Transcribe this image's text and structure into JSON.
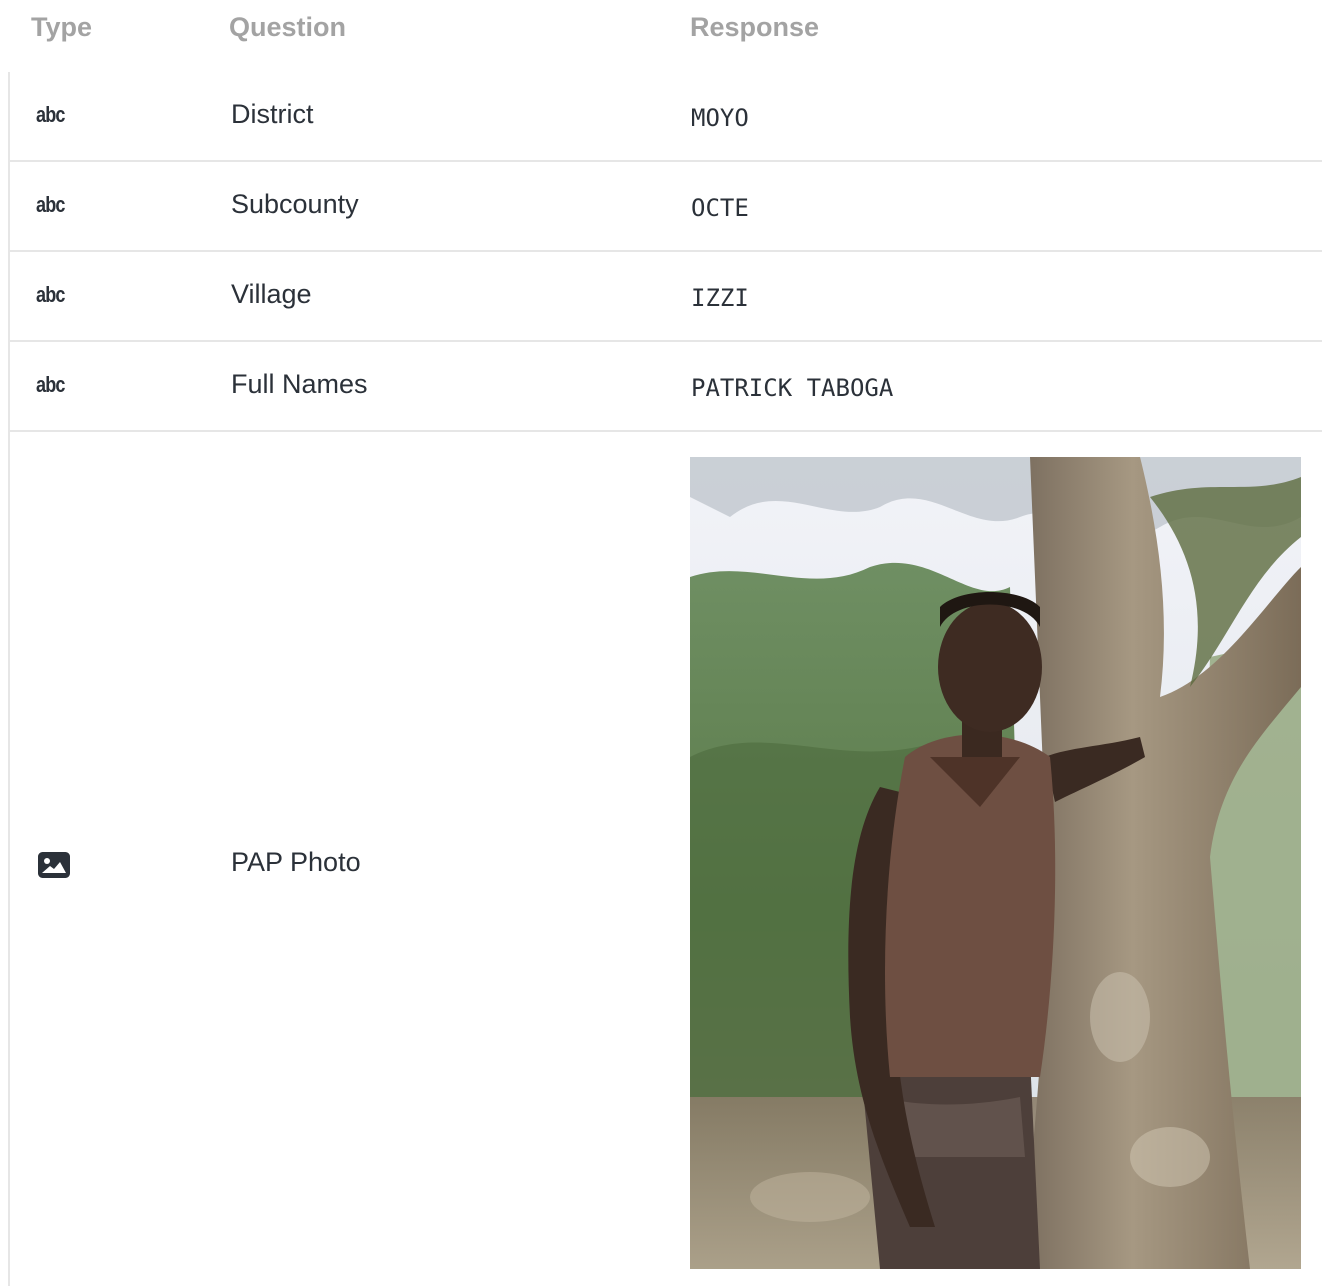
{
  "header": {
    "type_label": "Type",
    "question_label": "Question",
    "response_label": "Response"
  },
  "rows": [
    {
      "type_icon": "abc-text-icon",
      "type_text": "abc",
      "question": "District",
      "response": "MOYO"
    },
    {
      "type_icon": "abc-text-icon",
      "type_text": "abc",
      "question": "Subcounty",
      "response": "OCTE"
    },
    {
      "type_icon": "abc-text-icon",
      "type_text": "abc",
      "question": "Village",
      "response": "IZZI"
    },
    {
      "type_icon": "abc-text-icon",
      "type_text": "abc",
      "question": "Full Names",
      "response": "PATRICK TABOGA"
    },
    {
      "type_icon": "image-icon",
      "question": "PAP Photo",
      "response_image": "photo of man standing by tree"
    }
  ],
  "colors": {
    "header_text": "#a3a3a3",
    "body_text": "#2b3139",
    "divider": "#e6e6e6"
  }
}
